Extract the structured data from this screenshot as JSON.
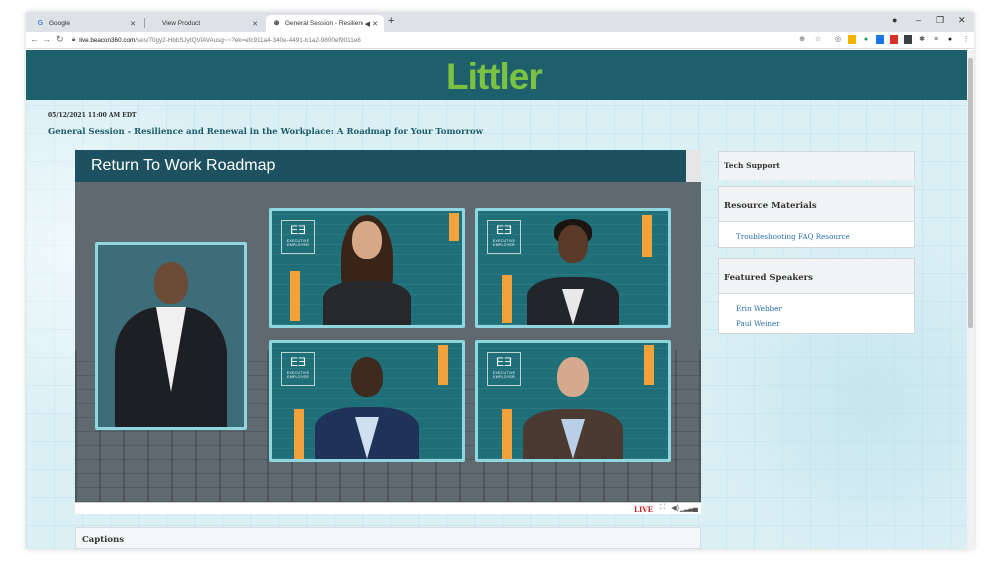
{
  "browser": {
    "tabs": [
      {
        "label": "Google",
        "icon": "google-icon",
        "active": false
      },
      {
        "label": "View Product",
        "icon": "",
        "active": false
      },
      {
        "label": "General Session - Resilience",
        "icon": "globe-icon",
        "active": true
      }
    ],
    "url_host": "live.beacon360.com",
    "url_path": "/ses/70gy2-HbbSJytQVlAVAusg~~?ek=efc911a4-340e-4491-b1a2-9800ef9011e8"
  },
  "header": {
    "logo_text": "Littler",
    "logo_color": "#7cc242",
    "bar_color": "#1e5f6c"
  },
  "session": {
    "datetime": "05/12/2021 11:00 AM EDT",
    "title": "General Session - Resilience and Renewal in the Workplace: A Roadmap for Your Tomorrow"
  },
  "video": {
    "slide_title": "Return To Work Roadmap",
    "tile_logo_line1": "EXECUTIVE",
    "tile_logo_line2": "EMPLOYER",
    "live_label": "LIVE"
  },
  "captions": {
    "label": "Captions"
  },
  "sidebar": {
    "tech_support": "Tech Support",
    "resource_materials": {
      "title": "Resource Materials",
      "links": [
        "Troubleshooting FAQ Resource"
      ]
    },
    "featured_speakers": {
      "title": "Featured Speakers",
      "speakers": [
        "Erin Webber",
        "Paul Weiner"
      ]
    }
  }
}
